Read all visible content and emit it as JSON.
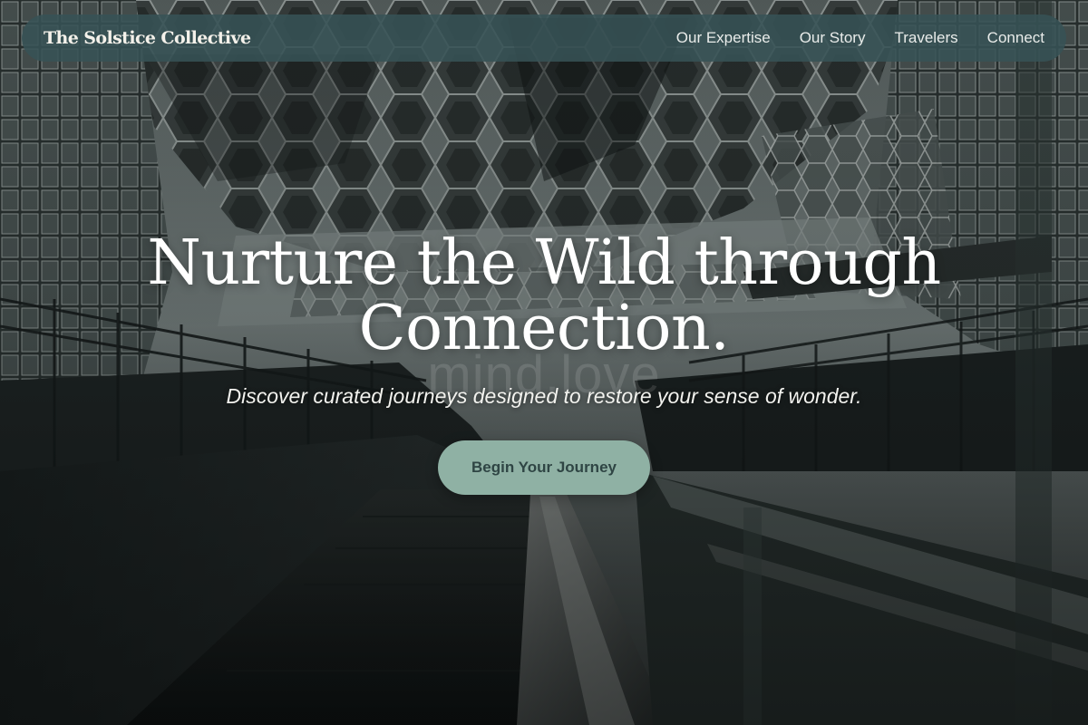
{
  "header": {
    "brand": "The Solstice Collective",
    "nav": [
      {
        "label": "Our Expertise"
      },
      {
        "label": "Our Story"
      },
      {
        "label": "Travelers"
      },
      {
        "label": "Connect"
      }
    ]
  },
  "hero": {
    "title_line1": "Nurture the Wild through",
    "title_line2": "Connection.",
    "ghost_text": "mind.love",
    "subtitle": "Discover curated journeys designed to restore your sense of wonder.",
    "cta_label": "Begin Your Journey"
  },
  "colors": {
    "nav_bar": "#375255",
    "cta_background": "#8fb1a4",
    "cta_text": "#2f4544",
    "heading_text": "#ffffff"
  }
}
